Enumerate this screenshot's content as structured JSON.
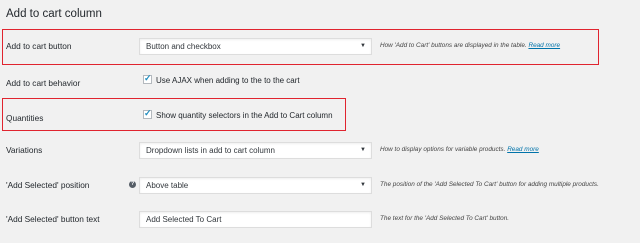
{
  "section": {
    "title": "Add to cart column"
  },
  "rows": {
    "add_to_cart_button": {
      "label": "Add to cart button",
      "select_value": "Button and checkbox",
      "description": "How 'Add to Cart' buttons are displayed in the table.",
      "link": "Read more"
    },
    "add_to_cart_behavior": {
      "label": "Add to cart behavior",
      "checkbox_label": "Use AJAX when adding to the to the cart",
      "checked": true
    },
    "quantities": {
      "label": "Quantities",
      "checkbox_label": "Show quantity selectors in the Add to Cart column",
      "checked": true
    },
    "variations": {
      "label": "Variations",
      "select_value": "Dropdown lists in add to cart column",
      "description": "How to display options for variable products.",
      "link": "Read more"
    },
    "add_selected_position": {
      "label": "'Add Selected' position",
      "select_value": "Above table",
      "description": "The position of the 'Add Selected To Cart' button for adding multiple products."
    },
    "add_selected_button_text": {
      "label": "'Add Selected' button text",
      "input_value": "Add Selected To Cart",
      "description": "The text for the 'Add Selected To Cart' button."
    }
  },
  "icons": {
    "dropdown_arrow": "▼",
    "help": "?",
    "check": "✓"
  },
  "colors": {
    "highlight_border": "#e0242f",
    "link": "#0073aa",
    "checkbox_tick": "#1e8cbe",
    "background": "#f1f1f1"
  }
}
